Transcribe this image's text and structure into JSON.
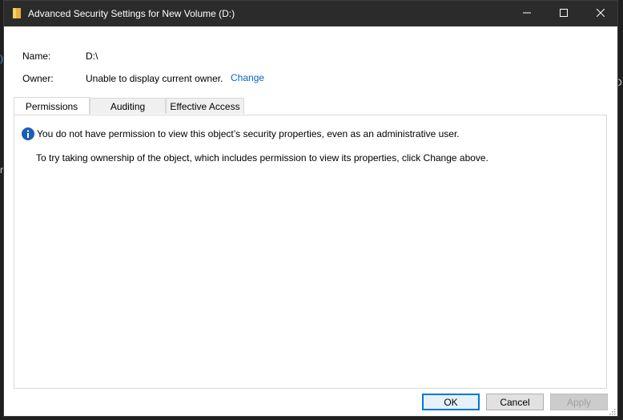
{
  "window": {
    "title": "Advanced Security Settings for New Volume (D:)"
  },
  "background": {
    "right_fragment": "D",
    "left_fragment": ")",
    "left_fragment2": "r"
  },
  "fields": {
    "name_label": "Name:",
    "name_value": "D:\\",
    "owner_label": "Owner:",
    "owner_value": "Unable to display current owner.",
    "change_link": "Change"
  },
  "tabs": [
    {
      "label": "Permissions",
      "active": true
    },
    {
      "label": "Auditing",
      "active": false
    },
    {
      "label": "Effective Access",
      "active": false
    }
  ],
  "panel": {
    "message": "You do not have permission to view this object’s security properties, even as an administrative user.",
    "hint": "To try taking ownership of the object, which includes permission to view its properties, click Change above."
  },
  "buttons": {
    "ok": "OK",
    "cancel": "Cancel",
    "apply": "Apply"
  },
  "colors": {
    "titlebar": "#2b2b2b",
    "link": "#0066cc",
    "info_icon": "#1a5fb4",
    "default_button_border": "#0078d7"
  },
  "icons": {
    "title": "folder-icon",
    "minimize": "minimize-icon",
    "maximize": "maximize-icon",
    "close": "close-icon",
    "info": "info-icon",
    "grip": "resize-grip-icon"
  }
}
